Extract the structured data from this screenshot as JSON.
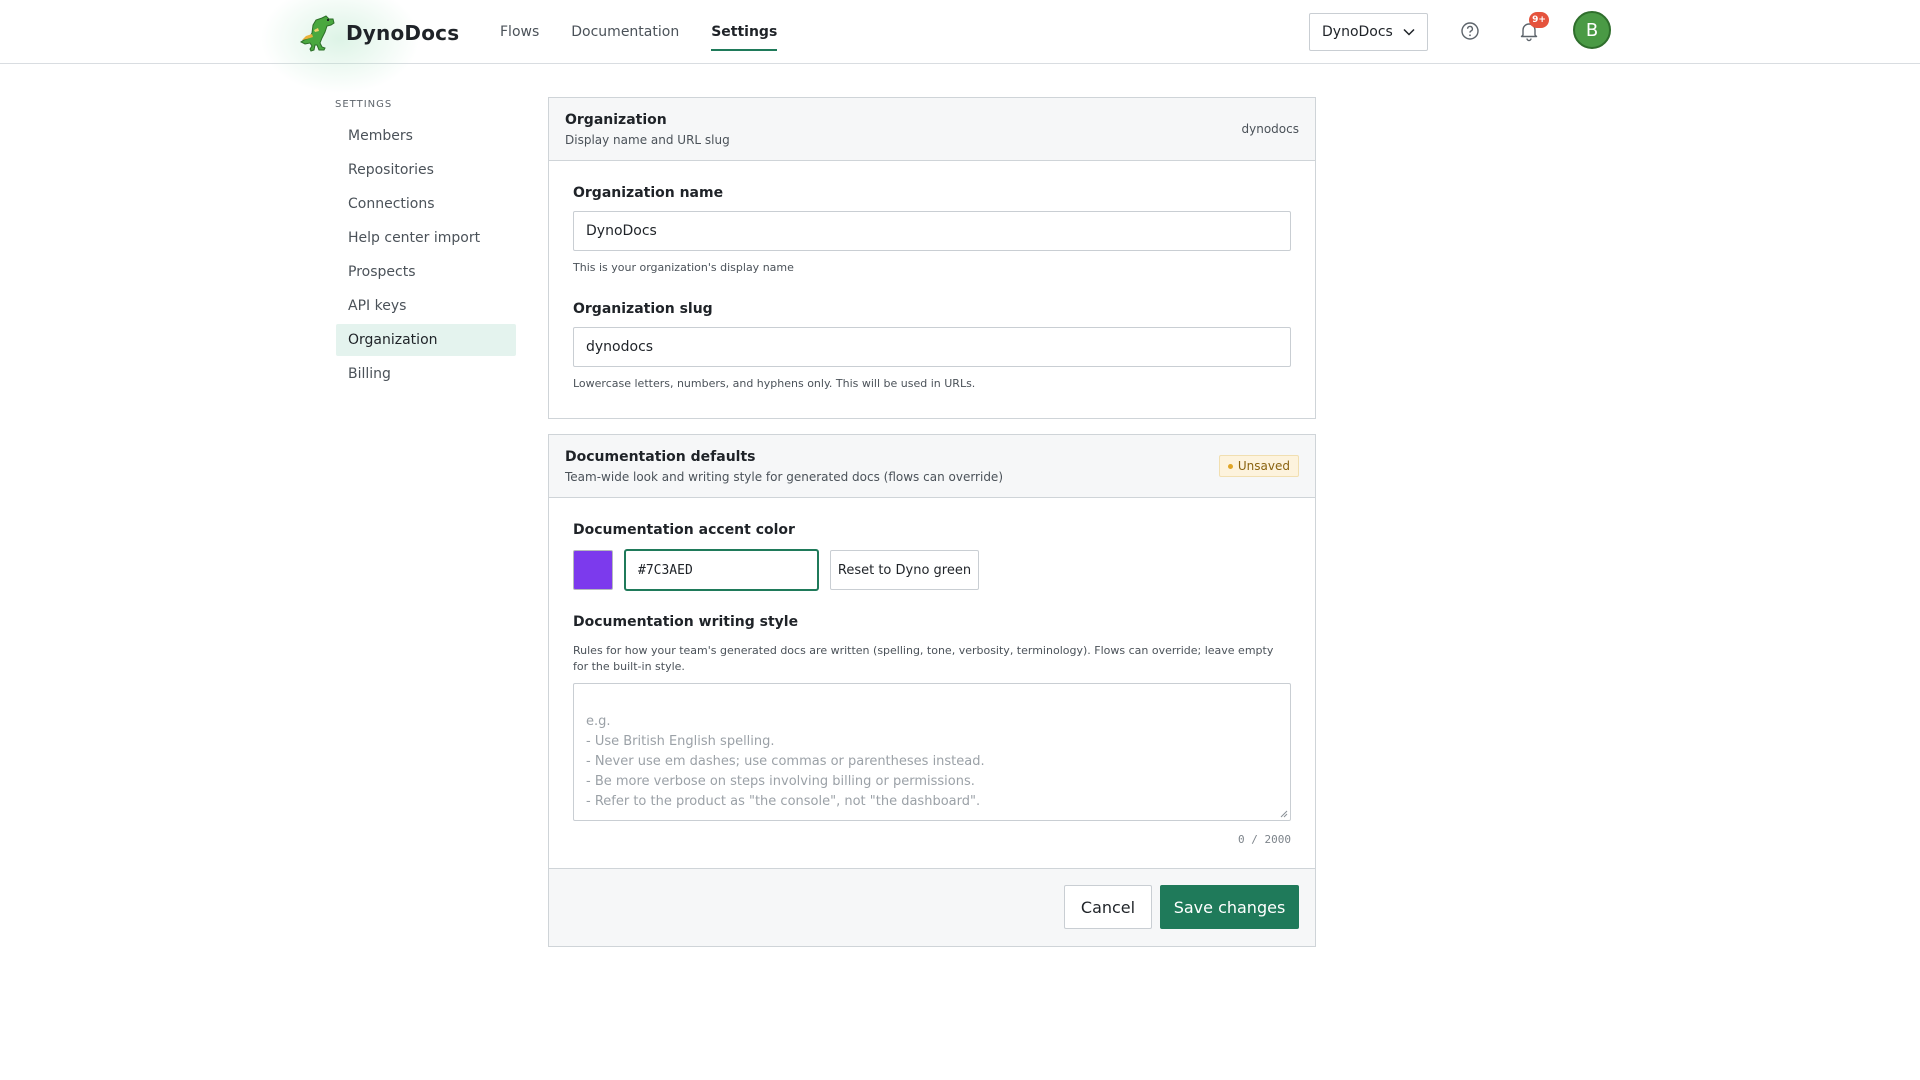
{
  "header": {
    "brand": "DynoDocs",
    "nav": [
      {
        "label": "Flows",
        "active": false
      },
      {
        "label": "Documentation",
        "active": false
      },
      {
        "label": "Settings",
        "active": true
      }
    ],
    "org_selector": "DynoDocs",
    "notification_badge": "9+",
    "avatar_initial": "B"
  },
  "sidebar": {
    "heading": "SETTINGS",
    "items": [
      {
        "label": "Members"
      },
      {
        "label": "Repositories"
      },
      {
        "label": "Connections"
      },
      {
        "label": "Help center import"
      },
      {
        "label": "Prospects"
      },
      {
        "label": "API keys"
      },
      {
        "label": "Organization",
        "active": true
      },
      {
        "label": "Billing"
      }
    ]
  },
  "organization": {
    "title": "Organization",
    "subtitle": "Display name and URL slug",
    "slug_display": "dynodocs",
    "name_label": "Organization name",
    "name_value": "DynoDocs",
    "name_hint": "This is your organization's display name",
    "slug_label": "Organization slug",
    "slug_value": "dynodocs",
    "slug_hint": "Lowercase letters, numbers, and hyphens only. This will be used in URLs."
  },
  "doc_defaults": {
    "title": "Documentation defaults",
    "subtitle": "Team-wide look and writing style for generated docs (flows can override)",
    "status": "Unsaved",
    "accent_label": "Documentation accent color",
    "accent_value": "#7C3AED",
    "reset_label": "Reset to Dyno green",
    "style_label": "Documentation writing style",
    "style_desc": "Rules for how your team's generated docs are written (spelling, tone, verbosity, terminology). Flows can override; leave empty for the built-in style.",
    "style_placeholder": "e.g.\n- Use British English spelling.\n- Never use em dashes; use commas or parentheses instead.\n- Be more verbose on steps involving billing or permissions.\n- Refer to the product as \"the console\", not \"the dashboard\".",
    "counter": "0 / 2000",
    "cancel_label": "Cancel",
    "save_label": "Save changes"
  },
  "colors": {
    "brand_green": "#1f7a5a",
    "accent_purple": "#7C3AED",
    "badge_red": "#e5533d",
    "avatar_green": "#4a9a45"
  },
  "icons": {
    "logo": "dino-logo-icon",
    "org_dropdown": "chevron-down-icon",
    "help": "help-circle-icon",
    "notifications": "bell-icon"
  }
}
